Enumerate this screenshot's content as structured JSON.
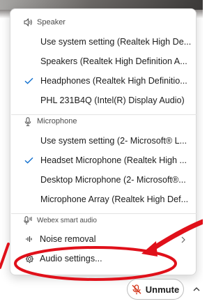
{
  "speaker": {
    "header": "Speaker",
    "header_icon": "speaker-icon",
    "options": [
      {
        "label": "Use system setting (Realtek High De...",
        "selected": false
      },
      {
        "label": "Speakers (Realtek High Definition A...",
        "selected": false
      },
      {
        "label": "Headphones (Realtek High Definitio...",
        "selected": true
      },
      {
        "label": "PHL 231B4Q (Intel(R) Display Audio)",
        "selected": false
      }
    ]
  },
  "microphone": {
    "header": "Microphone",
    "header_icon": "microphone-icon",
    "options": [
      {
        "label": "Use system setting (2- Microsoft® L...",
        "selected": false
      },
      {
        "label": "Headset Microphone (Realtek High ...",
        "selected": true
      },
      {
        "label": "Desktop Microphone (2- Microsoft®...",
        "selected": false
      },
      {
        "label": "Microphone Array (Realtek High Def...",
        "selected": false
      }
    ]
  },
  "smart_audio": {
    "header": "Webex smart audio",
    "header_icon": "smart-audio-icon",
    "noise_removal_label": "Noise removal",
    "noise_removal_icon": "noise-removal-icon"
  },
  "audio_settings": {
    "label": "Audio settings...",
    "icon": "gear-icon"
  },
  "toolbar": {
    "unmute_label": "Unmute",
    "unmute_icon": "microphone-muted-icon",
    "expand_icon": "chevron-up-icon"
  },
  "colors": {
    "accent": "#1170cf",
    "mute_red": "#d4371c",
    "annotation_red": "#e0101a"
  }
}
